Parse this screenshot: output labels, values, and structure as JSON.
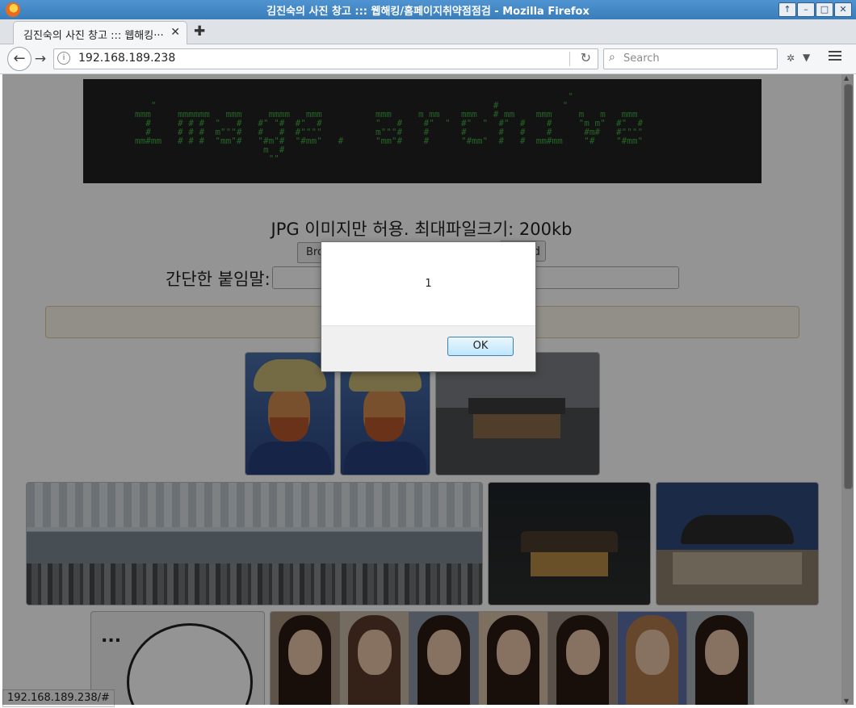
{
  "window": {
    "title": "김진숙의 사진 창고 ::: 웹해킹/홈페이지취약점점검 - Mozilla Firefox",
    "controls": [
      "↑",
      "–",
      "□",
      "✕"
    ]
  },
  "tab": {
    "label": "김진숙의 사진 창고 ::: 웹해킹···",
    "close": "✕",
    "new_tab": "✚"
  },
  "nav": {
    "back": "←",
    "forward": "→",
    "url": "192.168.189.238",
    "reload": "↻",
    "search_placeholder": "Search",
    "addon_dropdown": "▼"
  },
  "page": {
    "banner_ascii": "                                                                                 \"\n   \"                                                               #            \"\nmmm     mmmmmm   mmm     mmmm   mmm          mmm     m mm    mmm   # mm    mmm     m   m   mmm\n  #     # # #  \"   #   #\" \"#  #\"  #          \"   #    #\"  \"  #\"  \"  #\"  #    #     \"m m\"  #\"  #\n  #     # # #  m\"\"\"#   #   #  #\"\"\"\"          m\"\"\"#    #      #      #   #    #      #m#   #\"\"\"\"\nmm#mm   # # #  \"mm\"#   \"#m\"#  \"#mm\"   #      \"mm\"#    #      \"#mm\"  #   #  mm#mm    \"#    \"#mm\"\n                        m  #\n                         \"\"",
    "upload_note": "JPG 이미지만 허용. 최대파일크기: 200kb",
    "browse_label": "Browse...",
    "upload_label": "Upload",
    "memo_label": "간단한 붙임말:",
    "memo_value": "",
    "rage_text": "..."
  },
  "status_url": "192.168.189.238/#",
  "dialog": {
    "message": "1",
    "ok_label": "OK"
  },
  "scrollbar": {
    "up": "▲",
    "down": "▼"
  }
}
